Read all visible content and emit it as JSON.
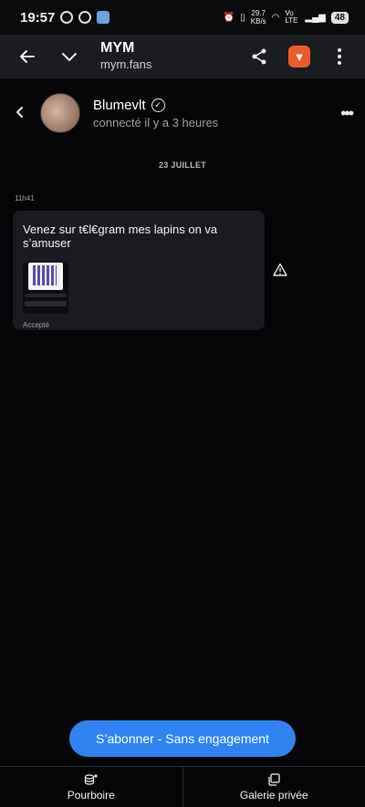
{
  "status_bar": {
    "time": "19:57",
    "net_speed_value": "29.7",
    "net_speed_unit": "KB/s",
    "network": "Vo LTE",
    "battery": "48"
  },
  "browser": {
    "title": "MYM",
    "domain": "mym.fans",
    "icons": [
      "back-arrow-icon",
      "chevron-down-icon",
      "share-icon",
      "brave-lion-icon",
      "more-vertical-icon"
    ]
  },
  "chat_header": {
    "name": "Blumevlt",
    "presence": "connecté il y a 3 heures"
  },
  "conversation": {
    "date": "23 JUILLET",
    "message": {
      "time": "11h41",
      "text": "Venez sur t€l€gram mes lapins on va s’amuser",
      "status": "Accepté"
    }
  },
  "cta": {
    "label": "S’abonner - Sans engagement"
  },
  "bottom_nav": [
    {
      "label": "Pourboire",
      "icon": "tip-coins-icon"
    },
    {
      "label": "Galerie privée",
      "icon": "gallery-copy-icon"
    }
  ],
  "colors": {
    "background": "#050507",
    "bubble": "#1a1b20",
    "accent": "#2f83f0",
    "brave": "#ef5a2a"
  }
}
